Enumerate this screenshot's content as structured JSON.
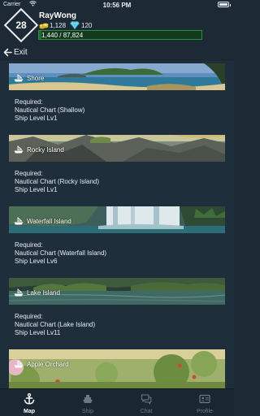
{
  "status_bar": {
    "carrier": "Carrier",
    "time": "10:56 PM",
    "wifi_icon": "wifi-icon",
    "battery_icon": "battery-icon"
  },
  "player": {
    "level": "28",
    "name": "RayWong",
    "gold": "1,128",
    "gems": "120",
    "xp_text": "1,440 / 87,824",
    "xp_fraction": 0.0164
  },
  "exit_label": "Exit",
  "locations": [
    {
      "name": "Shore",
      "required_label": "Required:",
      "chart": "Nautical Chart (Shallow)",
      "ship_level": "Ship Level Lv1"
    },
    {
      "name": "Rocky Island",
      "required_label": "Required:",
      "chart": "Nautical Chart (Rocky Island)",
      "ship_level": "Ship Level Lv1"
    },
    {
      "name": "Waterfall Island",
      "required_label": "Required:",
      "chart": "Nautical Chart (Waterfall Island)",
      "ship_level": "Ship Level Lv6"
    },
    {
      "name": "Lake Island",
      "required_label": "Required:",
      "chart": "Nautical Chart (Lake Island)",
      "ship_level": "Ship Level Lv11"
    },
    {
      "name": "Apple Orchard"
    }
  ],
  "tabs": [
    {
      "label": "Map",
      "icon": "anchor-icon",
      "active": true
    },
    {
      "label": "Ship",
      "icon": "ship-icon",
      "active": false
    },
    {
      "label": "Chat",
      "icon": "chat-bubbles-icon",
      "active": false
    },
    {
      "label": "Profile",
      "icon": "id-card-icon",
      "active": false
    }
  ],
  "colors": {
    "background": "#1d2a35",
    "xp_bar": "#1f6a2e",
    "gem": "#4ec6e8",
    "gold": "#e8c23a",
    "active_tab": "#ffffff",
    "inactive_tab": "#6b7885"
  }
}
